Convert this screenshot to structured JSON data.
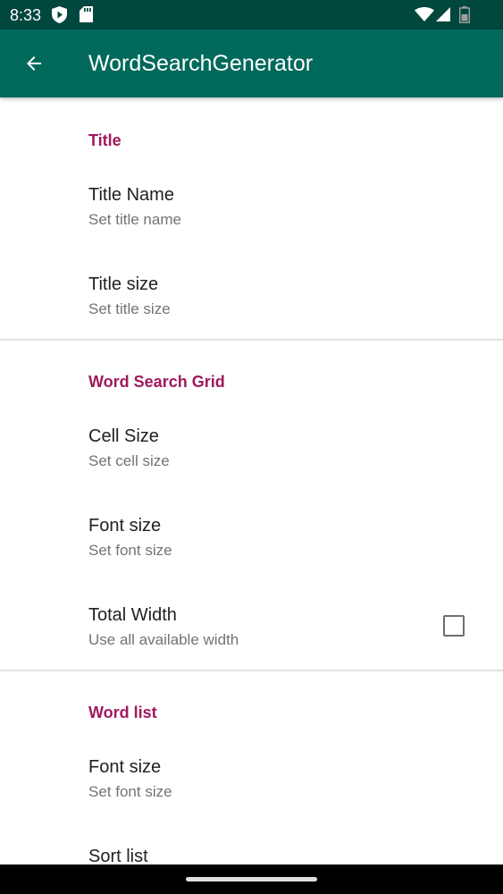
{
  "status_bar": {
    "time": "8:33",
    "icons": [
      "shield-icon",
      "sd-card-icon",
      "wifi-icon",
      "signal-icon",
      "battery-icon"
    ]
  },
  "app_bar": {
    "title": "WordSearchGenerator",
    "back_icon": "arrow-back-icon"
  },
  "colors": {
    "status_bar": "#00473d",
    "app_bar": "#00695c",
    "category_accent": "#a0195d"
  },
  "sections": [
    {
      "title": "Title",
      "items": [
        {
          "title": "Title Name",
          "summary": "Set title name"
        },
        {
          "title": "Title size",
          "summary": "Set title size"
        }
      ]
    },
    {
      "title": "Word Search Grid",
      "items": [
        {
          "title": "Cell Size",
          "summary": "Set cell size"
        },
        {
          "title": "Font size",
          "summary": "Set font size"
        },
        {
          "title": "Total Width",
          "summary": "Use all available width",
          "checkbox": {
            "checked": false
          }
        }
      ]
    },
    {
      "title": "Word list",
      "items": [
        {
          "title": "Font size",
          "summary": "Set font size"
        },
        {
          "title": "Sort list"
        }
      ]
    }
  ],
  "nav_bar": {
    "home_handle": "home-gesture-handle"
  }
}
